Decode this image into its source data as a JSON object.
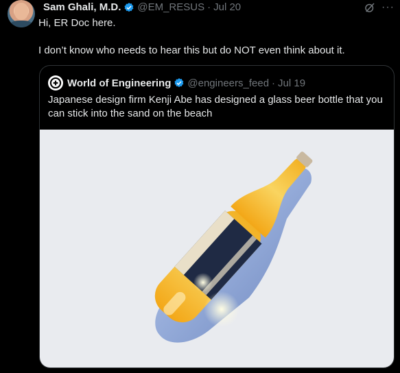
{
  "tweet": {
    "author_name": "Sam Ghali, M.D.",
    "handle": "@EM_RESUS",
    "separator": "·",
    "date": "Jul 20",
    "line1": "Hi, ER Doc here.",
    "line2": "I don’t know who needs to hear this but do NOT even think about it."
  },
  "quote": {
    "author_name": "World of Engineering",
    "handle": "@engineers_feed",
    "separator": "·",
    "date": "Jul 19",
    "text": "Japanese design firm Kenji Abe has designed a glass beer bottle that you can stick into the sand on the beach"
  },
  "icons": {
    "verified": "verified-badge-icon",
    "grok": "grok-icon",
    "more": "more-icon",
    "logo": "world-of-engineering-logo"
  },
  "colors": {
    "background": "#000000",
    "text": "#e7e9ea",
    "muted": "#71767b",
    "verified": "#1d9bf0",
    "border": "#2f3336"
  }
}
